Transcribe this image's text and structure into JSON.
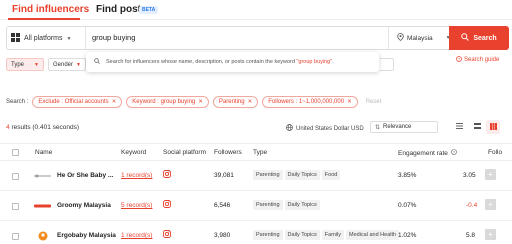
{
  "tabs": [
    {
      "label": "Find influencers",
      "active": true
    },
    {
      "label": "Find posts",
      "badge": "BETA"
    }
  ],
  "search": {
    "platform_label": "All platforms",
    "query": "group buying",
    "location": "Malaysia",
    "button_label": "Search",
    "suggestion_prefix": "Search for influencers whose name, description, or posts contain the keyword ",
    "suggestion_keyword": "\"group buying\"",
    "suggestion_suffix": "."
  },
  "guide_label": "Search guide",
  "filters": [
    {
      "label": "Type",
      "active": true
    },
    {
      "label": "Gender",
      "active": false
    }
  ],
  "active_filters": {
    "label": "Search :",
    "chips": [
      "Exclude : Official accounts",
      "Keyword : group buying",
      "Parenting",
      "Followers : 1~1,000,000,000"
    ],
    "reset_label": "Reset"
  },
  "results": {
    "count": "4",
    "suffix": "results (0.401 seconds)",
    "currency": "United States Dollar USD",
    "sort": "Relevance"
  },
  "table": {
    "headers": {
      "name": "Name",
      "keyword": "Keyword",
      "platform": "Social platform",
      "followers": "Followers",
      "type": "Type",
      "engagement": "Engagement rate",
      "follower_growth": "Follo"
    },
    "rows": [
      {
        "name": "He Or She Baby ...",
        "keyword": "1 record(s)",
        "followers": "39,081",
        "tags": [
          "Parenting",
          "Daily Topics",
          "Food"
        ],
        "engagement": "3.85%",
        "growth": "3.05",
        "growth_negative": false
      },
      {
        "name": "Groomy Malaysia",
        "keyword": "5 record(s)",
        "followers": "6,546",
        "tags": [
          "Parenting",
          "Daily Topics"
        ],
        "engagement": "0.07%",
        "growth": "-0.4",
        "growth_negative": true
      },
      {
        "name": "Ergobaby Malaysia",
        "keyword": "1 record(s)",
        "followers": "3,980",
        "tags": [
          "Parenting",
          "Daily Topics",
          "Family",
          "Medical and Health"
        ],
        "engagement": "1.02%",
        "growth": "5.8",
        "growth_negative": false
      }
    ]
  },
  "colors": {
    "accent": "#e8412d",
    "chip_bg": "#fdeceb",
    "tag_bg": "#f1f1f1"
  }
}
